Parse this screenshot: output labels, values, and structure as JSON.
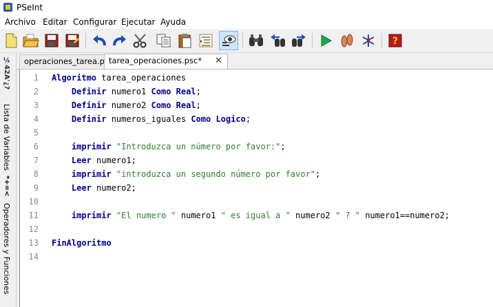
{
  "window": {
    "title": "PSeInt"
  },
  "menu": [
    "Archivo",
    "Editar",
    "Configurar",
    "Ejecutar",
    "Ayuda"
  ],
  "sidebar": {
    "variables_label": "Lista de Variables",
    "variables_icon_text": "*+=<",
    "operators_label": "Operadores y Funciones",
    "operators_icon_text": "*+=<"
  },
  "tabs": [
    {
      "label": "operaciones_tarea.psc",
      "active": false
    },
    {
      "label": "tarea_operaciones.psc*",
      "active": true,
      "close": "✕"
    }
  ],
  "colors": {
    "keyword": "#00008b",
    "string": "#2e7d2e",
    "line_number": "#888888"
  },
  "code_lines": [
    {
      "num": "1",
      "tokens": [
        [
          "kw",
          "Algoritmo"
        ],
        [
          "id",
          " tarea_operaciones"
        ]
      ]
    },
    {
      "num": "2",
      "tokens": [
        [
          "id",
          "    "
        ],
        [
          "kw",
          "Definir"
        ],
        [
          "id",
          " numero1 "
        ],
        [
          "kw",
          "Como"
        ],
        [
          "id",
          " "
        ],
        [
          "kw",
          "Real"
        ],
        [
          "id",
          ";"
        ]
      ]
    },
    {
      "num": "3",
      "tokens": [
        [
          "id",
          "    "
        ],
        [
          "kw",
          "Definir"
        ],
        [
          "id",
          " numero2 "
        ],
        [
          "kw",
          "Como"
        ],
        [
          "id",
          " "
        ],
        [
          "kw",
          "Real"
        ],
        [
          "id",
          ";"
        ]
      ]
    },
    {
      "num": "4",
      "tokens": [
        [
          "id",
          "    "
        ],
        [
          "kw",
          "Definir"
        ],
        [
          "id",
          " numeros_iguales "
        ],
        [
          "kw",
          "Como"
        ],
        [
          "id",
          " "
        ],
        [
          "kw",
          "Logico"
        ],
        [
          "id",
          ";"
        ]
      ]
    },
    {
      "num": "5",
      "tokens": []
    },
    {
      "num": "6",
      "tokens": [
        [
          "id",
          "    "
        ],
        [
          "kw",
          "imprimir"
        ],
        [
          "id",
          " "
        ],
        [
          "str",
          "\"Introduzca un número por favor:\""
        ],
        [
          "id",
          ";"
        ]
      ]
    },
    {
      "num": "7",
      "tokens": [
        [
          "id",
          "    "
        ],
        [
          "kw",
          "Leer"
        ],
        [
          "id",
          " numero1;"
        ]
      ]
    },
    {
      "num": "8",
      "tokens": [
        [
          "id",
          "    "
        ],
        [
          "kw",
          "imprimir"
        ],
        [
          "id",
          " "
        ],
        [
          "str",
          "\"introduzca un segundo número por favor\""
        ],
        [
          "id",
          ";"
        ]
      ]
    },
    {
      "num": "9",
      "tokens": [
        [
          "id",
          "    "
        ],
        [
          "kw",
          "Leer"
        ],
        [
          "id",
          " numero2;"
        ]
      ]
    },
    {
      "num": "10",
      "tokens": []
    },
    {
      "num": "11",
      "tokens": [
        [
          "id",
          "    "
        ],
        [
          "kw",
          "imprimir"
        ],
        [
          "id",
          " "
        ],
        [
          "str",
          "\"El numero \""
        ],
        [
          "id",
          " numero1 "
        ],
        [
          "str",
          "\" es igual a \""
        ],
        [
          "id",
          " numero2 "
        ],
        [
          "str",
          "\" ? \""
        ],
        [
          "id",
          " numero1==numero2;"
        ]
      ]
    },
    {
      "num": "12",
      "tokens": []
    },
    {
      "num": "13",
      "tokens": [
        [
          "kw",
          "FinAlgoritmo"
        ]
      ]
    },
    {
      "num": "14",
      "tokens": []
    }
  ],
  "toolbar": [
    "new-file-icon",
    "open-folder-icon",
    "save-icon",
    "save-as-icon",
    "undo-icon",
    "redo-icon",
    "cut-icon",
    "copy-icon",
    "paste-icon",
    "indent-icon",
    "find-icon",
    "binoculars-icon",
    "find-previous-icon",
    "find-next-icon",
    "run-icon",
    "step-icon",
    "flowchart-icon",
    "help-icon"
  ]
}
